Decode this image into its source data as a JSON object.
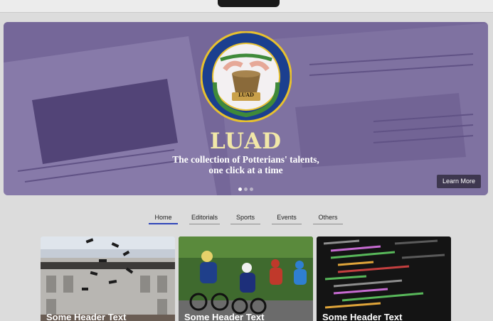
{
  "hero": {
    "logo_ring_top": "LUAD SCHOOL PUB",
    "logo_ring_bottom": "POTTER AND CLAY CHRISTIAN SCHOOL",
    "logo_banner": "LUAD",
    "title": "LUAD",
    "subtitle_line1": "The collection of Potterians' talents,",
    "subtitle_line2": "one click at a time",
    "learn_more": "Learn More",
    "slides": 3,
    "active_slide": 1
  },
  "tabs": [
    {
      "label": "Home",
      "active": true
    },
    {
      "label": "Editorials",
      "active": false
    },
    {
      "label": "Sports",
      "active": false
    },
    {
      "label": "Events",
      "active": false
    },
    {
      "label": "Others",
      "active": false
    }
  ],
  "cards": [
    {
      "title": "Some Header Text",
      "image": "graduation-caps"
    },
    {
      "title": "Some Header Text",
      "image": "cyclists"
    },
    {
      "title": "Some Header Text",
      "image": "code-screen"
    }
  ],
  "colors": {
    "overlay": "#3a2476",
    "title": "#f1e7a8",
    "tab_active": "#2f45b8"
  }
}
